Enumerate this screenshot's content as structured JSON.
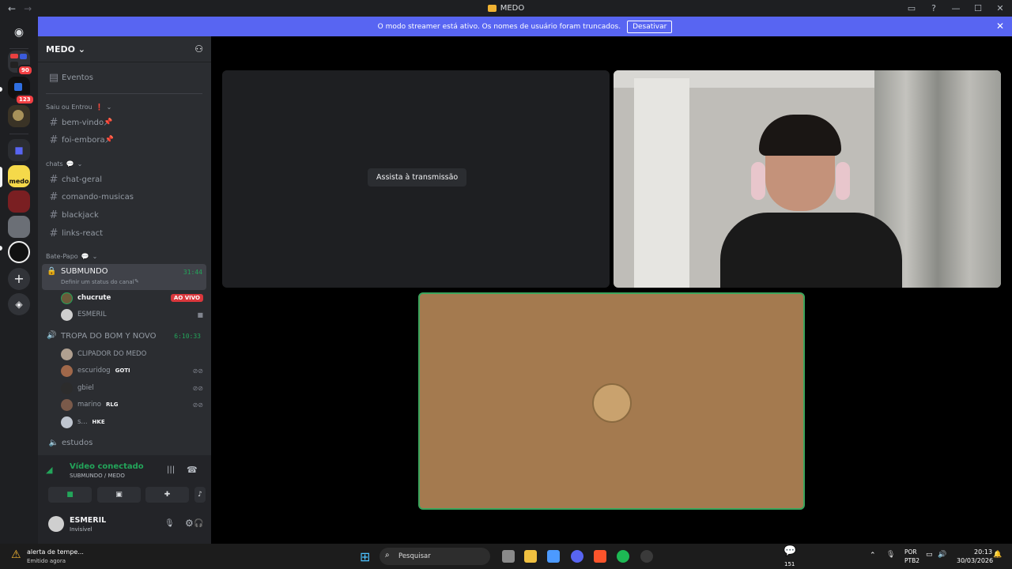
{
  "window": {
    "title": "MEDO"
  },
  "banner": {
    "text": "O modo streamer está ativo. Os nomes de usuário foram truncados.",
    "button_label": "Desativar"
  },
  "rail": {
    "badges": [
      "90",
      "123"
    ]
  },
  "server": {
    "name": "MEDO"
  },
  "events_label": "Eventos",
  "categories": {
    "saiu": "Saiu ou Entrou",
    "chats": "chats",
    "bate_papo": "Bate-Papo"
  },
  "channels": {
    "bem_vindo": "bem-vindo",
    "foi_embora": "foi-embora",
    "chat_geral": "chat-geral",
    "comando_musicas": "comando-musicas",
    "blackjack": "blackjack",
    "links_react": "links-react",
    "estudos": "estudos"
  },
  "voice_channels": {
    "submundo": {
      "name": "SUBMUNDO",
      "status_placeholder": "Definir um status do canal",
      "timer": "31:44",
      "members": [
        {
          "name": "chucrute",
          "badge": "AO VIVO"
        },
        {
          "name": "ESMERIL"
        }
      ]
    },
    "tropa": {
      "name": "TROPA DO BOM Y NOVO",
      "timer": "6:10:33",
      "members": [
        {
          "name": "CLIPADOR DO MEDO",
          "tag": ""
        },
        {
          "name": "escuridog",
          "tag": "GOTI"
        },
        {
          "name": "gbiel",
          "tag": ""
        },
        {
          "name": "marino",
          "tag": "RLG"
        },
        {
          "name": "s...",
          "tag": "HKE"
        }
      ]
    }
  },
  "voice_panel": {
    "status": "Vídeo conectado",
    "location": "SUBMUNDO / MEDO"
  },
  "current_user": {
    "name": "ESMERIL",
    "status": "Invisível"
  },
  "stage": {
    "watch_stream_label": "Assista à transmissão",
    "colors": {
      "empty_tile": "#1e1f22",
      "camera_tile": "#a47a4f",
      "speaking_border": "#3ba55c"
    }
  },
  "taskbar": {
    "notification_title": "alerta de tempe...",
    "notification_sub": "Emitido agora",
    "search_label": "Pesquisar",
    "chat_count": "151",
    "language": "POR",
    "layout": "PTB2",
    "time": "20:13",
    "date": "30/03/2026"
  }
}
